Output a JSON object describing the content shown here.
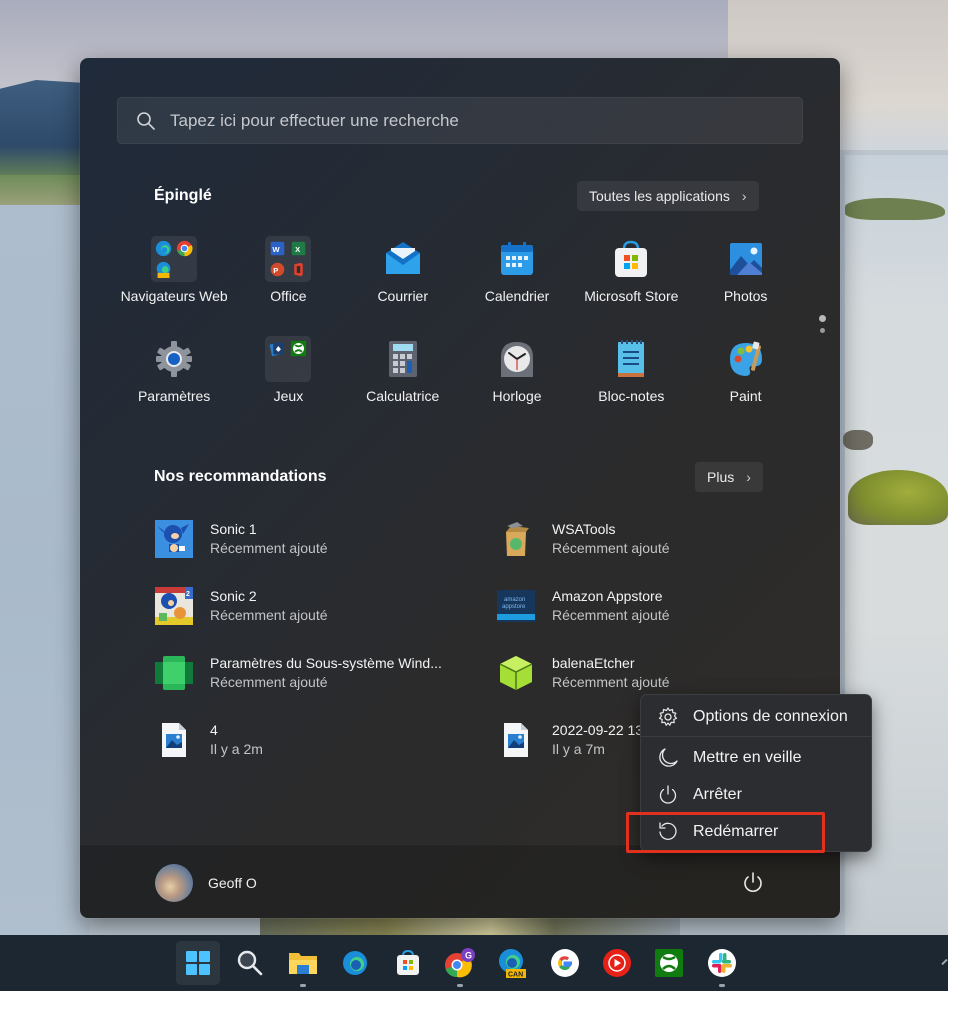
{
  "search": {
    "placeholder": "Tapez ici pour effectuer une recherche"
  },
  "pinned": {
    "title": "Épinglé",
    "all_apps_label": "Toutes les applications",
    "items": [
      {
        "label": "Navigateurs Web",
        "icon": "browsers-folder-icon"
      },
      {
        "label": "Office",
        "icon": "office-folder-icon"
      },
      {
        "label": "Courrier",
        "icon": "mail-icon"
      },
      {
        "label": "Calendrier",
        "icon": "calendar-icon"
      },
      {
        "label": "Microsoft Store",
        "icon": "store-icon"
      },
      {
        "label": "Photos",
        "icon": "photos-icon"
      },
      {
        "label": "Paramètres",
        "icon": "settings-gear-icon"
      },
      {
        "label": "Jeux",
        "icon": "games-folder-icon"
      },
      {
        "label": "Calculatrice",
        "icon": "calculator-icon"
      },
      {
        "label": "Horloge",
        "icon": "clock-icon"
      },
      {
        "label": "Bloc-notes",
        "icon": "notepad-icon"
      },
      {
        "label": "Paint",
        "icon": "paint-palette-icon"
      }
    ],
    "page_count": 2,
    "current_page": 1
  },
  "recommendations": {
    "title": "Nos recommandations",
    "more_label": "Plus",
    "items": [
      {
        "name": "Sonic 1",
        "sub": "Récemment ajouté",
        "icon": "sonic1-icon"
      },
      {
        "name": "WSATools",
        "sub": "Récemment ajouté",
        "icon": "wsatools-icon"
      },
      {
        "name": "Sonic 2",
        "sub": "Récemment ajouté",
        "icon": "sonic2-icon"
      },
      {
        "name": "Amazon Appstore",
        "sub": "Récemment ajouté",
        "icon": "amazon-appstore-icon"
      },
      {
        "name": "Paramètres du Sous-système Wind...",
        "sub": "Récemment ajouté",
        "icon": "wsa-settings-icon"
      },
      {
        "name": "balenaEtcher",
        "sub": "Récemment ajouté",
        "icon": "balena-etcher-icon"
      },
      {
        "name": "4",
        "sub": "Il y a 2m",
        "icon": "image-file-icon"
      },
      {
        "name": "2022-09-22 13",
        "sub": "Il y a 7m",
        "icon": "image-file-icon"
      }
    ]
  },
  "user": {
    "name": "Geoff O"
  },
  "power_menu": {
    "items": [
      {
        "label": "Options de connexion",
        "icon": "gear-icon"
      },
      {
        "label": "Mettre en veille",
        "icon": "moon-icon"
      },
      {
        "label": "Arrêter",
        "icon": "power-icon"
      },
      {
        "label": "Redémarrer",
        "icon": "restart-icon",
        "highlighted": true
      }
    ],
    "highlight_color": "#e0301e"
  },
  "taskbar": {
    "items": [
      {
        "name": "start",
        "icon": "windows-start-icon",
        "active": true
      },
      {
        "name": "search",
        "icon": "search-icon"
      },
      {
        "name": "file-explorer",
        "icon": "folder-icon",
        "running": true
      },
      {
        "name": "edge",
        "icon": "edge-icon"
      },
      {
        "name": "microsoft-store",
        "icon": "store-icon"
      },
      {
        "name": "chrome",
        "icon": "chrome-icon",
        "badge": "G",
        "running": true
      },
      {
        "name": "edge-canary",
        "icon": "edge-canary-icon",
        "badge": "CAN"
      },
      {
        "name": "google",
        "icon": "google-icon"
      },
      {
        "name": "youtube-music",
        "icon": "youtube-music-icon"
      },
      {
        "name": "xbox",
        "icon": "xbox-icon"
      },
      {
        "name": "slack",
        "icon": "slack-icon",
        "running": true
      }
    ]
  }
}
